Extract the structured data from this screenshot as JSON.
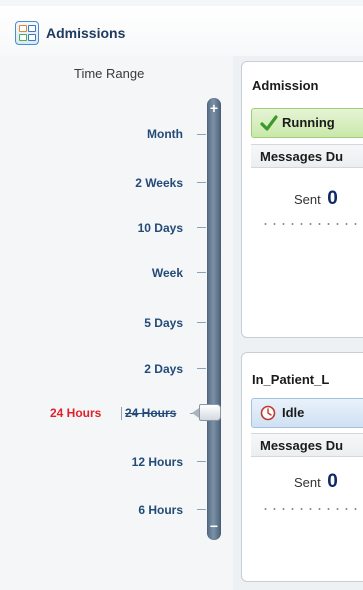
{
  "header": {
    "title": "Admissions",
    "icon": "dashboard-grid-icon"
  },
  "time_range": {
    "title": "Time Range",
    "plus_symbol": "+",
    "minus_symbol": "−",
    "ticks": [
      "Month",
      "2 Weeks",
      "10 Days",
      "Week",
      "5 Days",
      "2 Days",
      "24 Hours",
      "12 Hours",
      "6 Hours"
    ],
    "selected_label": "24 Hours",
    "selected_color": "#e0202a"
  },
  "panels": [
    {
      "title": "Admission",
      "status": "Running",
      "status_icon": "checkmark-icon",
      "section_title": "Messages Du",
      "sent_label": "Sent",
      "sent_value": "0"
    },
    {
      "title": "In_Patient_L",
      "status": "Idle",
      "status_icon": "clock-icon",
      "section_title": "Messages Du",
      "sent_label": "Sent",
      "sent_value": "0"
    }
  ]
}
